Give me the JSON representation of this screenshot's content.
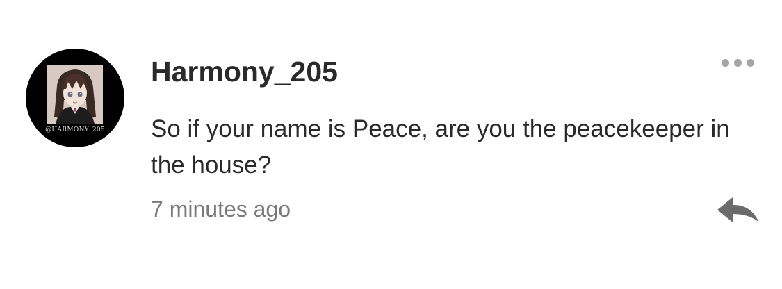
{
  "comment": {
    "avatar": {
      "handle_text": "@HARMONY_205",
      "icon": "anime-avatar-image",
      "background_color": "#000000"
    },
    "username": "Harmony_205",
    "text": "So if your name is Peace, are you the peacekeeper in the house?",
    "timestamp": "7 minutes ago",
    "actions": {
      "more_icon": "more-horizontal-icon",
      "reply_icon": "reply-arrow-icon",
      "icon_color": "#6b6b6b"
    }
  }
}
